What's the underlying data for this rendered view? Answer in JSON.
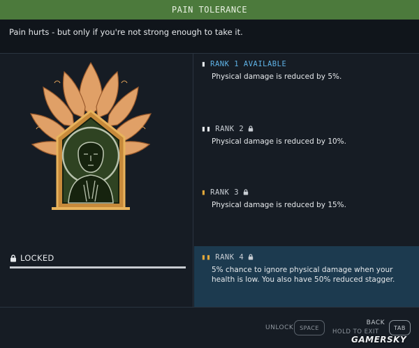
{
  "window": {
    "title": "PAIN TOLERANCE",
    "description": "Pain hurts - but only if you're not strong enough to take it."
  },
  "skill": {
    "icon": "meditating-figure-lotus-badge-icon",
    "status_label": "LOCKED",
    "status_icon": "lock-icon"
  },
  "ranks": [
    {
      "label": "RANK 1 AVAILABLE",
      "locked": false,
      "text": "Physical damage is reduced by 5%."
    },
    {
      "label": "RANK 2",
      "locked": true,
      "text": "Physical damage is reduced by 10%."
    },
    {
      "label": "RANK 3",
      "locked": true,
      "text": "Physical damage is reduced by 15%."
    },
    {
      "label": "RANK 4",
      "locked": true,
      "text": "5% chance to ignore physical damage when your health is low. You also have 50% reduced stagger."
    }
  ],
  "footer": {
    "unlock_label": "UNLOCK",
    "unlock_key": "SPACE",
    "back_label": "BACK",
    "hold_label": "HOLD TO EXIT",
    "back_key": "TAB"
  },
  "watermark": "GAMERSKY",
  "colors": {
    "title_bar": "#4c7a3c",
    "available_rank": "#5fb2e6",
    "rank_tick_gold": "#e0a73a",
    "selected_rank_bg": "#1c3a4f",
    "badge_petals": "#e0a067",
    "badge_core": "#2f4322"
  }
}
